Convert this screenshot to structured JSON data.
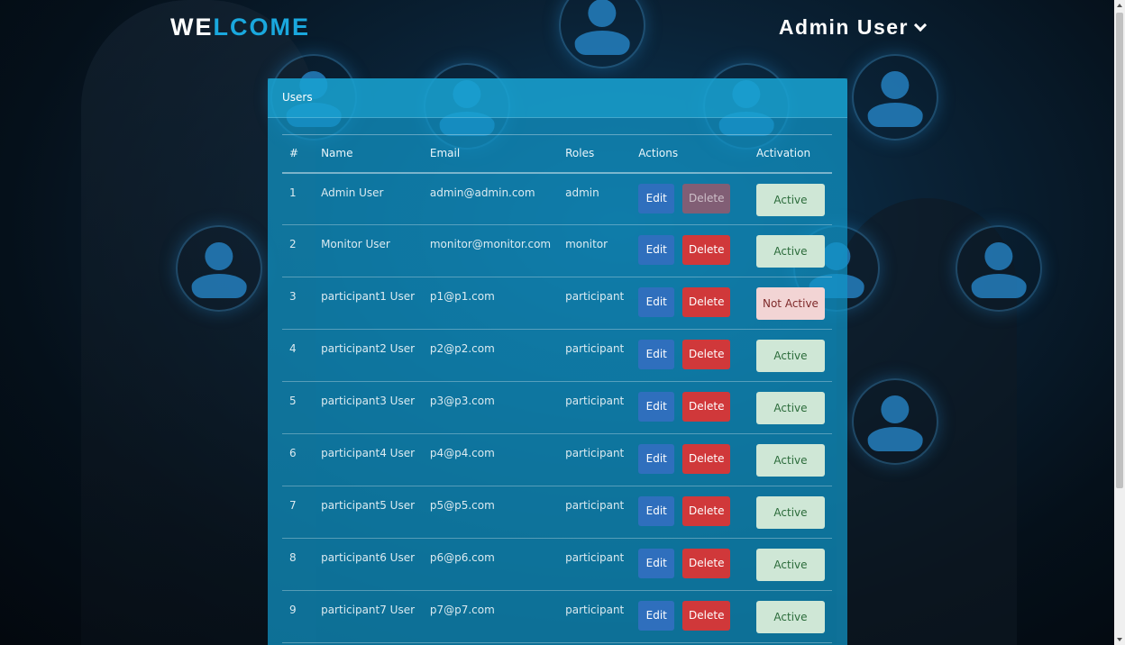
{
  "header": {
    "logo_part1": "WE",
    "logo_part2": "LCOME",
    "user_name": "Admin User"
  },
  "panel": {
    "title": "Users"
  },
  "table": {
    "columns": [
      "#",
      "Name",
      "Email",
      "Roles",
      "Actions",
      "Activation"
    ],
    "rows": [
      {
        "num": "1",
        "name": "Admin User",
        "email": "admin@admin.com",
        "role": "admin",
        "edit": "Edit",
        "delete": "Delete",
        "delete_disabled": true,
        "status": "Active"
      },
      {
        "num": "2",
        "name": "Monitor User",
        "email": "monitor@monitor.com",
        "role": "monitor",
        "edit": "Edit",
        "delete": "Delete",
        "delete_disabled": false,
        "status": "Active"
      },
      {
        "num": "3",
        "name": "participant1 User",
        "email": "p1@p1.com",
        "role": "participant",
        "edit": "Edit",
        "delete": "Delete",
        "delete_disabled": false,
        "status": "Not Active"
      },
      {
        "num": "4",
        "name": "participant2 User",
        "email": "p2@p2.com",
        "role": "participant",
        "edit": "Edit",
        "delete": "Delete",
        "delete_disabled": false,
        "status": "Active"
      },
      {
        "num": "5",
        "name": "participant3 User",
        "email": "p3@p3.com",
        "role": "participant",
        "edit": "Edit",
        "delete": "Delete",
        "delete_disabled": false,
        "status": "Active"
      },
      {
        "num": "6",
        "name": "participant4 User",
        "email": "p4@p4.com",
        "role": "participant",
        "edit": "Edit",
        "delete": "Delete",
        "delete_disabled": false,
        "status": "Active"
      },
      {
        "num": "7",
        "name": "participant5 User",
        "email": "p5@p5.com",
        "role": "participant",
        "edit": "Edit",
        "delete": "Delete",
        "delete_disabled": false,
        "status": "Active"
      },
      {
        "num": "8",
        "name": "participant6 User",
        "email": "p6@p6.com",
        "role": "participant",
        "edit": "Edit",
        "delete": "Delete",
        "delete_disabled": false,
        "status": "Active"
      },
      {
        "num": "9",
        "name": "participant7 User",
        "email": "p7@p7.com",
        "role": "participant",
        "edit": "Edit",
        "delete": "Delete",
        "delete_disabled": false,
        "status": "Active"
      }
    ]
  },
  "colors": {
    "accent": "#1aa8de",
    "edit_button": "#2f6fbd",
    "delete_button": "#d0383a",
    "active_badge": "#cfe7d6",
    "not_active_badge": "#f2d4d4"
  }
}
